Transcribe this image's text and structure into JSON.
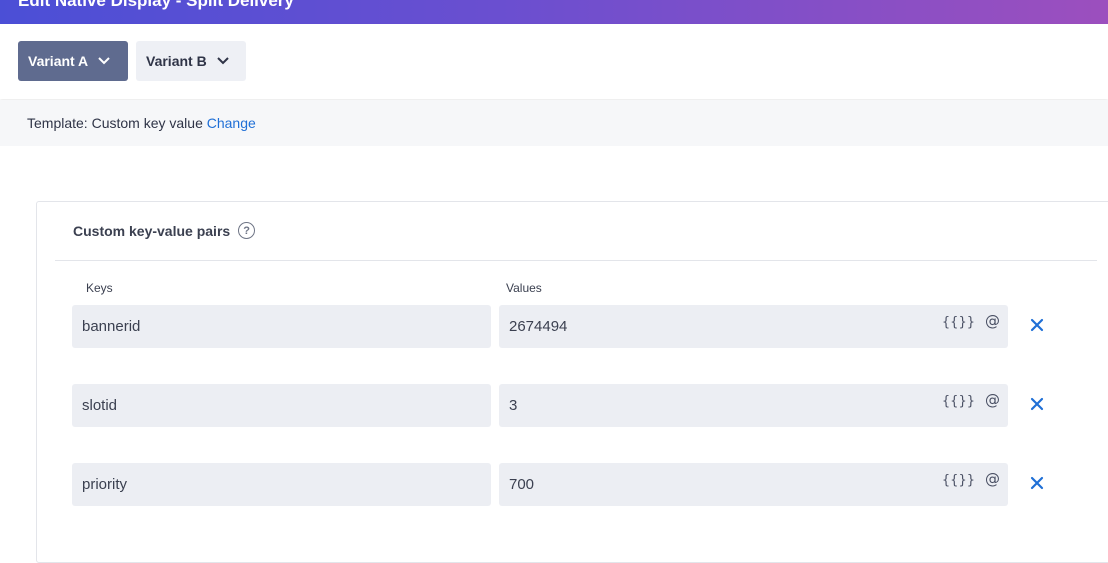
{
  "header": {
    "title": "Edit Native Display - Split Delivery"
  },
  "variants": [
    {
      "label": "Variant A",
      "active": true
    },
    {
      "label": "Variant B",
      "active": false
    }
  ],
  "template": {
    "prefix": "Template: Custom key value",
    "change_label": "Change"
  },
  "kv_panel": {
    "title": "Custom key-value pairs",
    "help_icon": "question-circle-icon",
    "keys_header": "Keys",
    "values_header": "Values",
    "rows": [
      {
        "key": "bannerid",
        "value": "2674494"
      },
      {
        "key": "slotid",
        "value": "3"
      },
      {
        "key": "priority",
        "value": "700"
      }
    ],
    "personalize_token": "{{}}",
    "mention_token": "@"
  },
  "colors": {
    "accent": "#1f6fd6",
    "active_variant": "#5f6b8f",
    "field_bg": "#eceef3"
  }
}
